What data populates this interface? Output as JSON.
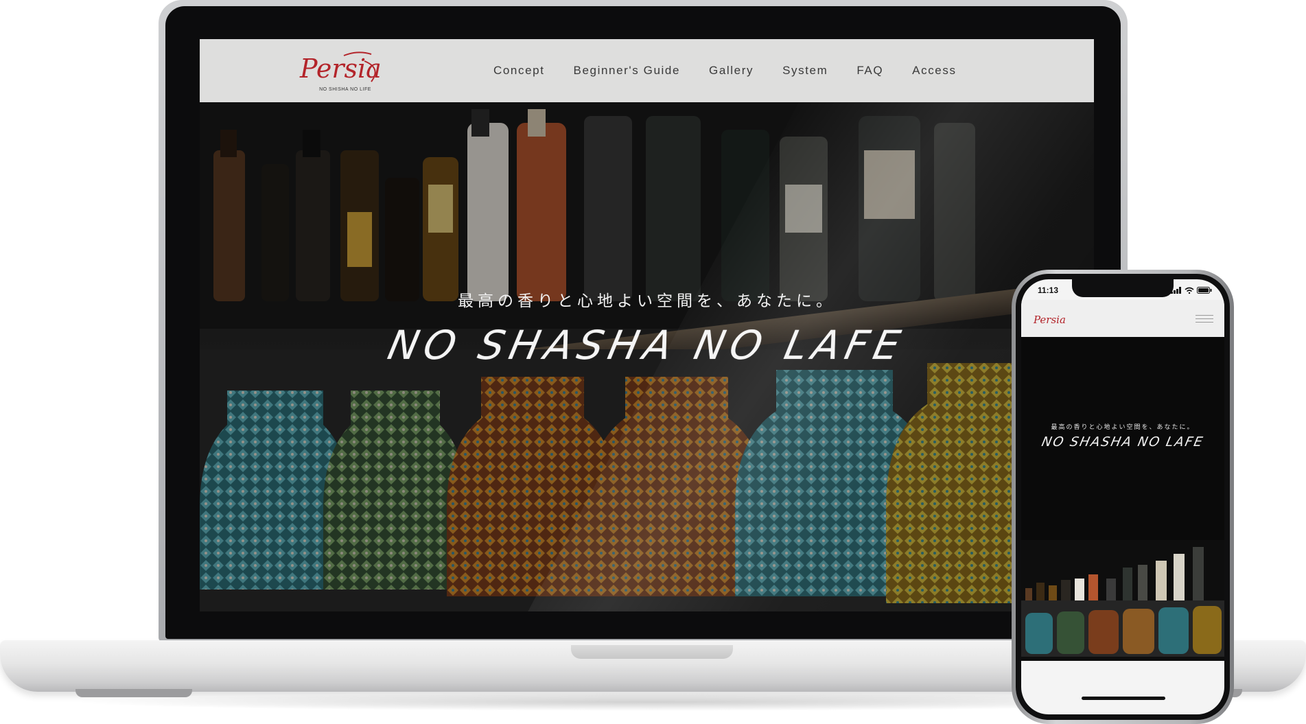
{
  "site": {
    "logo_text": "Persia",
    "logo_tagline": "NO SHISHA NO LIFE",
    "nav": [
      {
        "label": "Concept"
      },
      {
        "label": "Beginner's Guide"
      },
      {
        "label": "Gallery"
      },
      {
        "label": "System"
      },
      {
        "label": "FAQ"
      },
      {
        "label": "Access"
      }
    ],
    "hero": {
      "tagline": "最高の香りと心地よい空間を、あなたに。",
      "slogan": "NO SHASHA NO LAFE"
    },
    "brand_color": "#b3242a"
  },
  "phone": {
    "status_time": "11:13",
    "tagline": "最高の香りと心地よい空間を、あなたに。",
    "slogan": "NO SHASHA NO LAFE",
    "logo_text": "Persia"
  }
}
